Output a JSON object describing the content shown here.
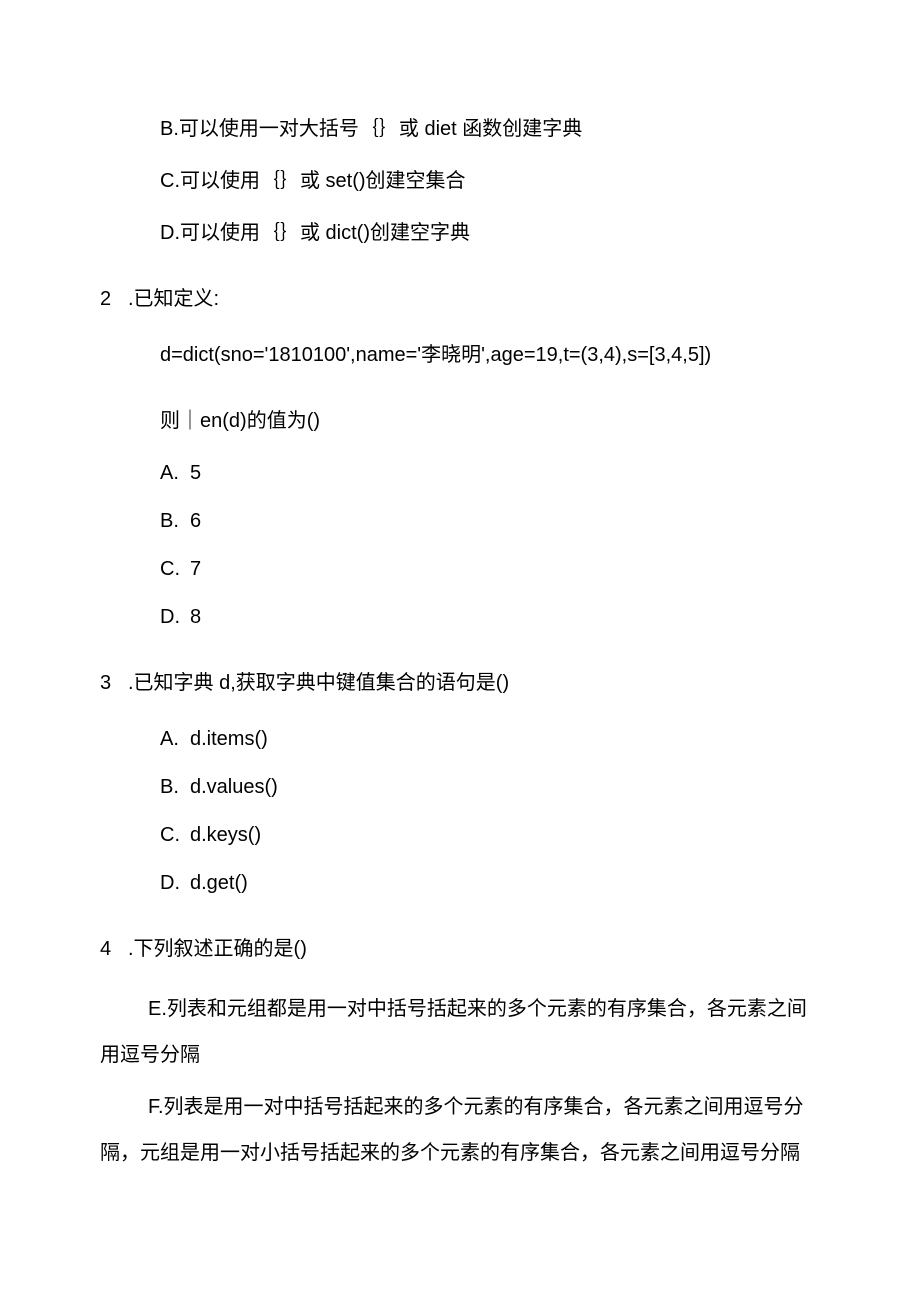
{
  "topOptions": {
    "b": "B.可以使用一对大括号｛｝或 diet 函数创建字典",
    "c": "C.可以使用｛｝或 set()创建空集合",
    "d": "D.可以使用｛｝或 dict()创建空字典"
  },
  "q2": {
    "number": "2",
    "stem": ".已知定义:",
    "code": "d=dict(sno='1810100',name='李晓明',age=19,t=(3,4),s=[3,4,5])",
    "prompt": "则｜en(d)的值为()",
    "opts": {
      "a": {
        "label": "A.",
        "value": "5"
      },
      "b": {
        "label": "B.",
        "value": "6"
      },
      "c": {
        "label": "C.",
        "value": "7"
      },
      "d": {
        "label": "D.",
        "value": "8"
      }
    }
  },
  "q3": {
    "number": "3",
    "stem": ".已知字典 d,获取字典中键值集合的语句是()",
    "opts": {
      "a": {
        "label": "A.",
        "value": "d.items()"
      },
      "b": {
        "label": "B.",
        "value": "d.values()"
      },
      "c": {
        "label": "C.",
        "value": "d.keys()"
      },
      "d": {
        "label": "D.",
        "value": "d.get()"
      }
    }
  },
  "q4": {
    "number": "4",
    "stem": ".下列叙述正确的是()",
    "e": "E.列表和元组都是用一对中括号括起来的多个元素的有序集合，各元素之间用逗号分隔",
    "f": "F.列表是用一对中括号括起来的多个元素的有序集合，各元素之间用逗号分隔，元组是用一对小括号括起来的多个元素的有序集合，各元素之间用逗号分隔"
  }
}
